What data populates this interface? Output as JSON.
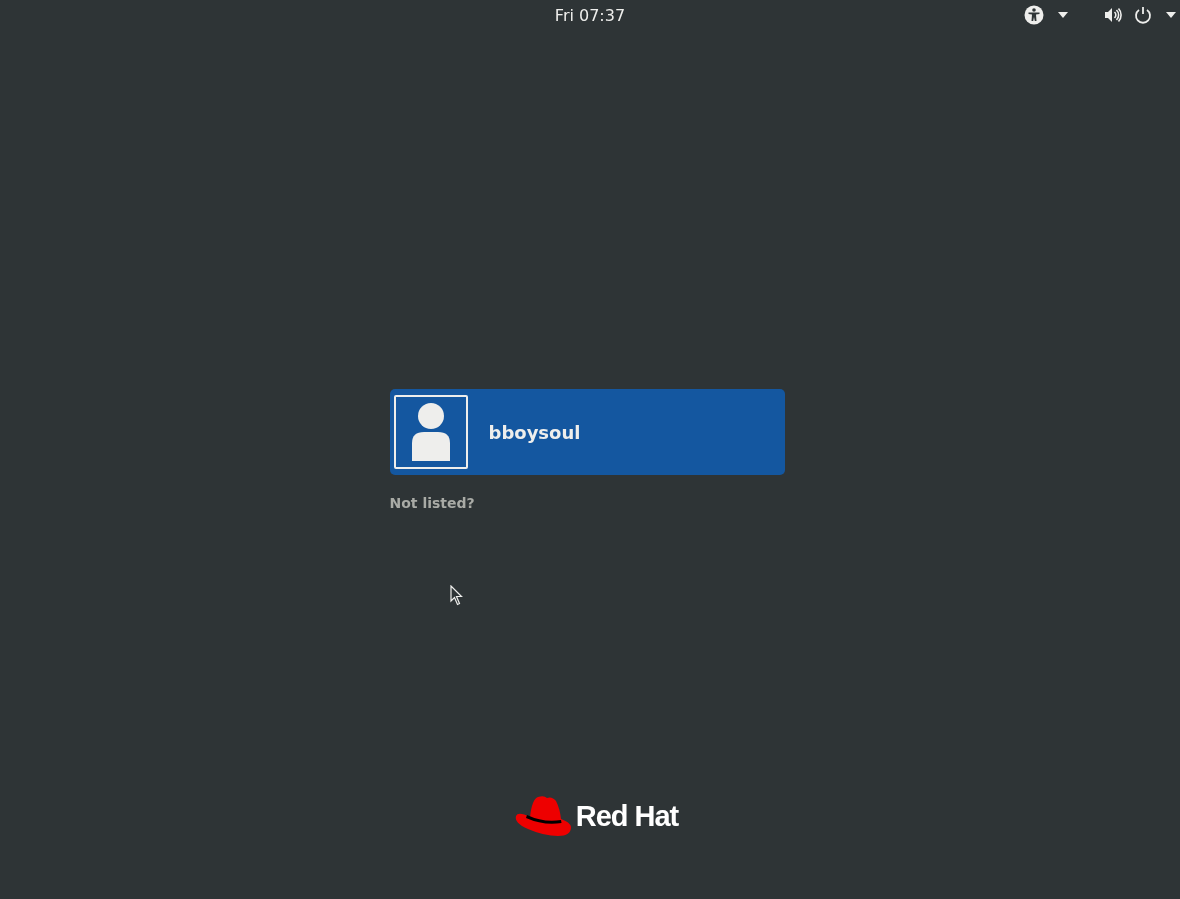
{
  "top_bar": {
    "clock": "Fri 07:37",
    "indicators": [
      {
        "kind": "accessibility",
        "menu": true
      },
      {
        "kind": "volume",
        "menu": false
      },
      {
        "kind": "power",
        "menu": true
      }
    ]
  },
  "users": [
    {
      "name": "bboysoul",
      "selected": true
    }
  ],
  "not_listed_link": "Not listed?",
  "logo": {
    "text": "Red Hat"
  }
}
